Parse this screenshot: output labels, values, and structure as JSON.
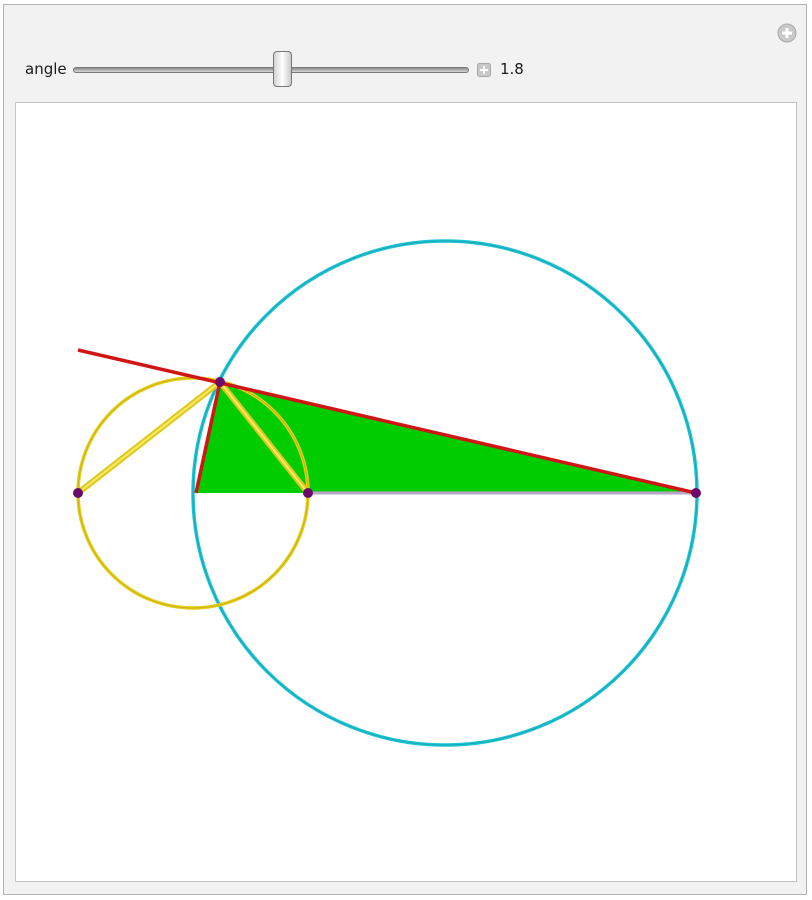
{
  "control": {
    "label": "angle",
    "value": "1.8",
    "slider_fraction": 0.53
  },
  "icons": {
    "top_right": "add-circle-icon",
    "slider_adjust": "add-square-icon"
  },
  "colors": {
    "panel_bg": "#f2f2f2",
    "cyan_circle": "#1fc4d4",
    "yellow": "#e6cf1c",
    "red": "#d11414",
    "green_fill": "#00cc00",
    "point": "#6b0a6b",
    "baseline": "#b9a3c9"
  }
}
